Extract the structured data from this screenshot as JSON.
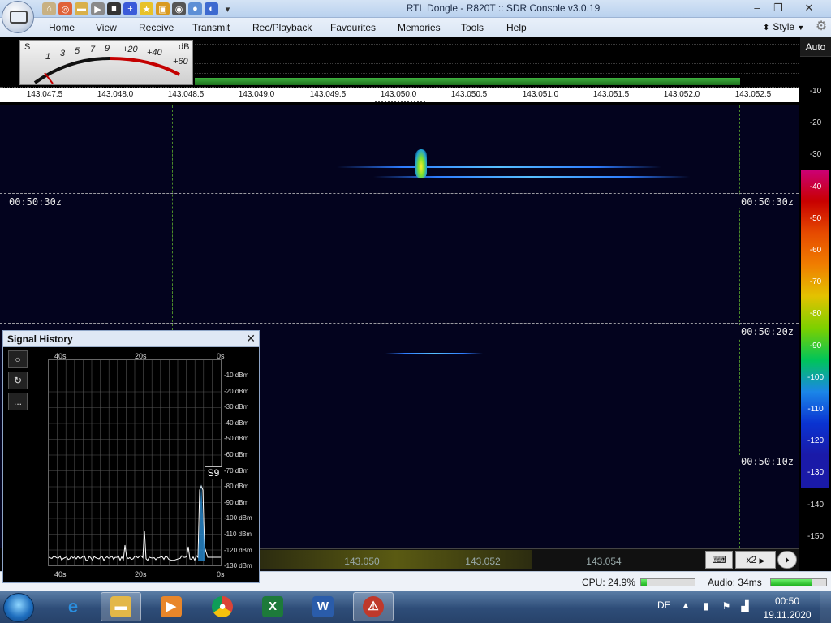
{
  "window": {
    "title": "RTL Dongle - R820T :: SDR Console v3.0.19",
    "minimize_icon": "minimize-icon",
    "maximize_icon": "maximize-icon",
    "close_icon": "close-icon"
  },
  "quick_access": [
    "home-icon",
    "lifebuoy-icon",
    "folder-icon",
    "play-icon",
    "stop-icon",
    "plus-icon",
    "star-icon",
    "lock-icon",
    "camera-icon",
    "drop-icon",
    "dial-icon",
    "dropdown-icon"
  ],
  "menu": {
    "items": [
      "Home",
      "View",
      "Receive",
      "Transmit",
      "Rec/Playback",
      "Favourites",
      "Memories",
      "Tools",
      "Help"
    ],
    "style": "Style"
  },
  "smeter": {
    "s_label": "S",
    "db_label": "dB",
    "scale": [
      "1",
      "3",
      "5",
      "7",
      "9",
      "+20",
      "+40",
      "+60"
    ]
  },
  "auto_button": "Auto",
  "ruler": {
    "labels": [
      "143.047.5",
      "143.048.0",
      "143.048.5",
      "143.049.0",
      "143.049.5",
      "143.050.0",
      "143.050.5",
      "143.051.0",
      "143.051.5",
      "143.052.0",
      "143.052.5"
    ]
  },
  "waterfall": {
    "timestamps": [
      "00:50:30z",
      "00:50:30z",
      "00:50:20z",
      "00:50:10z"
    ]
  },
  "db_scale": {
    "labels": [
      "-10",
      "-20",
      "-30",
      "-40",
      "-50",
      "-60",
      "-70",
      "-80",
      "-90",
      "-100",
      "-110",
      "-120",
      "-130",
      "-140",
      "-150"
    ],
    "colors": [
      "#000000",
      "#000000",
      "#000000",
      "#cc0077",
      "#c80000",
      "#e64a00",
      "#f07d00",
      "#e3c200",
      "#7bd000",
      "#00c45a",
      "#1b86e8",
      "#0a33d1",
      "#1a1aa8",
      "#000000",
      "#000000",
      "#000000"
    ]
  },
  "bottom_bar": {
    "freqs": [
      "143.050",
      "143.052",
      "143.054"
    ],
    "zoom": "x2",
    "keyboard_icon": "keyboard-icon",
    "play_icon": "play-circle-icon"
  },
  "status": {
    "cpu": "CPU: 24.9%",
    "cpu_fraction": 0.1,
    "audio": "Audio: 34ms",
    "audio_fraction": 0.75
  },
  "signal_history": {
    "title": "Signal History",
    "close": "✕",
    "top_axis": [
      "40s",
      "20s",
      "0s"
    ],
    "bottom_axis": [
      "40s",
      "20s",
      "0s"
    ],
    "db_axis": [
      "-10 dBm",
      "-20 dBm",
      "-30 dBm",
      "-40 dBm",
      "-50 dBm",
      "-60 dBm",
      "-70 dBm",
      "-80 dBm",
      "-90 dBm",
      "-100 dBm",
      "-110 dBm",
      "-120 dBm",
      "-130 dBm"
    ],
    "s_marker": "S9",
    "buttons": [
      "circle-icon",
      "refresh-icon",
      "more-icon"
    ],
    "more_label": "..."
  },
  "taskbar": {
    "apps": [
      "internet-explorer-icon",
      "file-explorer-icon",
      "media-player-icon",
      "chrome-icon",
      "excel-icon",
      "word-icon",
      "sdr-console-icon"
    ],
    "language": "DE",
    "time": "00:50",
    "date": "19.11.2020"
  }
}
